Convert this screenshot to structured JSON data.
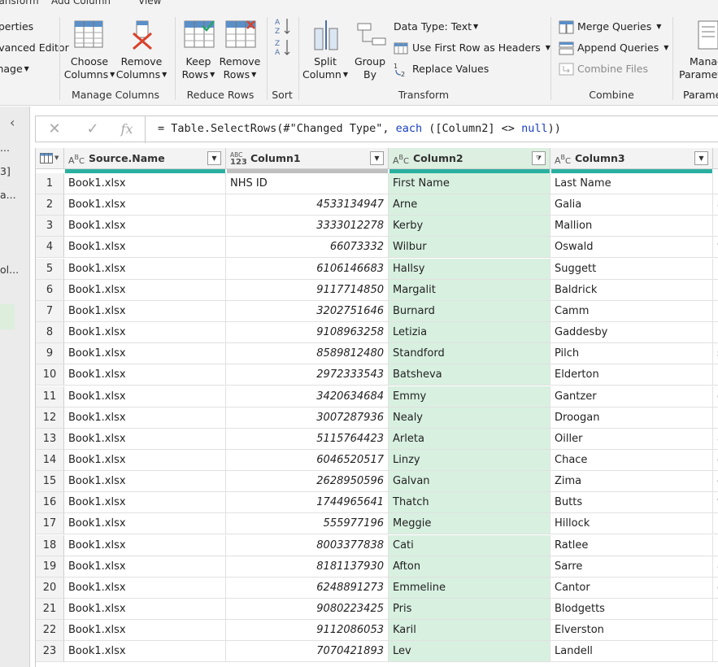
{
  "tabs": [
    "Transform",
    "Add Column",
    "View"
  ],
  "ribbon": {
    "partial_left": [
      "Properties",
      "Advanced Editor",
      "Manage"
    ],
    "manage_columns": {
      "choose_columns": [
        "Choose",
        "Columns"
      ],
      "remove_columns": [
        "Remove",
        "Columns"
      ],
      "group": "Manage Columns"
    },
    "reduce_rows": {
      "keep_rows": [
        "Keep",
        "Rows"
      ],
      "remove_rows": [
        "Remove",
        "Rows"
      ],
      "group": "Reduce Rows"
    },
    "sort": {
      "group": "Sort"
    },
    "transform": {
      "split_column": [
        "Split",
        "Column"
      ],
      "group_by": [
        "Group",
        "By"
      ],
      "data_type": "Data Type: Text",
      "use_first_row": "Use First Row as Headers",
      "replace_values": "Replace Values",
      "group": "Transform"
    },
    "combine": {
      "merge_queries": "Merge Queries",
      "append_queries": "Append Queries",
      "combine_files": "Combine Files",
      "group": "Combine"
    },
    "parameters": {
      "manage": [
        "Manage",
        "Parameters"
      ],
      "group": "Parameters"
    }
  },
  "left_panel": {
    "items": [
      "...",
      "3]",
      "a...",
      "ol..."
    ]
  },
  "formula": {
    "prefix": "= Table.SelectRows(#",
    "string": "\"Changed Type\"",
    "middle": ", ",
    "keyword": "each",
    "rest": " ([Column2] <> ",
    "null_kw": "null",
    "tail": "))"
  },
  "columns": [
    {
      "type_top": "A",
      "type_sub": "B",
      "type_sub2": "C",
      "name": "Source.Name"
    },
    {
      "type_top": "ABC",
      "type_sub": "123",
      "name": "Column1"
    },
    {
      "type_top": "A",
      "type_sub": "B",
      "type_sub2": "C",
      "name": "Column2"
    },
    {
      "type_top": "A",
      "type_sub": "B",
      "type_sub2": "C",
      "name": "Column3"
    }
  ],
  "rows": [
    [
      "1",
      "Book1.xlsx",
      "NHS ID",
      "First Name",
      "Last Name"
    ],
    [
      "2",
      "Book1.xlsx",
      "4533134947",
      "Arne",
      "Galia"
    ],
    [
      "3",
      "Book1.xlsx",
      "3333012278",
      "Kerby",
      "Mallion"
    ],
    [
      "4",
      "Book1.xlsx",
      "66073332",
      "Wilbur",
      "Oswald"
    ],
    [
      "5",
      "Book1.xlsx",
      "6106146683",
      "Hallsy",
      "Suggett"
    ],
    [
      "6",
      "Book1.xlsx",
      "9117714850",
      "Margalit",
      "Baldrick"
    ],
    [
      "7",
      "Book1.xlsx",
      "3202751646",
      "Burnard",
      "Camm"
    ],
    [
      "8",
      "Book1.xlsx",
      "9108963258",
      "Letizia",
      "Gaddesby"
    ],
    [
      "9",
      "Book1.xlsx",
      "8589812480",
      "Standford",
      "Pilch"
    ],
    [
      "10",
      "Book1.xlsx",
      "2972333543",
      "Batsheva",
      "Elderton"
    ],
    [
      "11",
      "Book1.xlsx",
      "3420634684",
      "Emmy",
      "Gantzer"
    ],
    [
      "12",
      "Book1.xlsx",
      "3007287936",
      "Nealy",
      "Droogan"
    ],
    [
      "13",
      "Book1.xlsx",
      "5115764423",
      "Arleta",
      "Oiller"
    ],
    [
      "14",
      "Book1.xlsx",
      "6046520517",
      "Linzy",
      "Chace"
    ],
    [
      "15",
      "Book1.xlsx",
      "2628950596",
      "Galvan",
      "Zima"
    ],
    [
      "16",
      "Book1.xlsx",
      "1744965641",
      "Thatch",
      "Butts"
    ],
    [
      "17",
      "Book1.xlsx",
      "555977196",
      "Meggie",
      "Hillock"
    ],
    [
      "18",
      "Book1.xlsx",
      "8003377838",
      "Cati",
      "Ratlee"
    ],
    [
      "19",
      "Book1.xlsx",
      "8181137930",
      "Afton",
      "Sarre"
    ],
    [
      "20",
      "Book1.xlsx",
      "6248891273",
      "Emmeline",
      "Cantor"
    ],
    [
      "21",
      "Book1.xlsx",
      "9080223425",
      "Pris",
      "Blodgetts"
    ],
    [
      "22",
      "Book1.xlsx",
      "9112086053",
      "Karil",
      "Elverston"
    ],
    [
      "23",
      "Book1.xlsx",
      "7070421893",
      "Lev",
      "Landell"
    ]
  ],
  "next_col_hints": [
    "l",
    "a",
    "l",
    "w",
    "r",
    "r",
    "l",
    "l",
    "s",
    "r",
    "e",
    "l",
    "a",
    "e",
    "g",
    "t",
    "l",
    "l",
    "a",
    "e",
    "l",
    "r",
    "l"
  ]
}
